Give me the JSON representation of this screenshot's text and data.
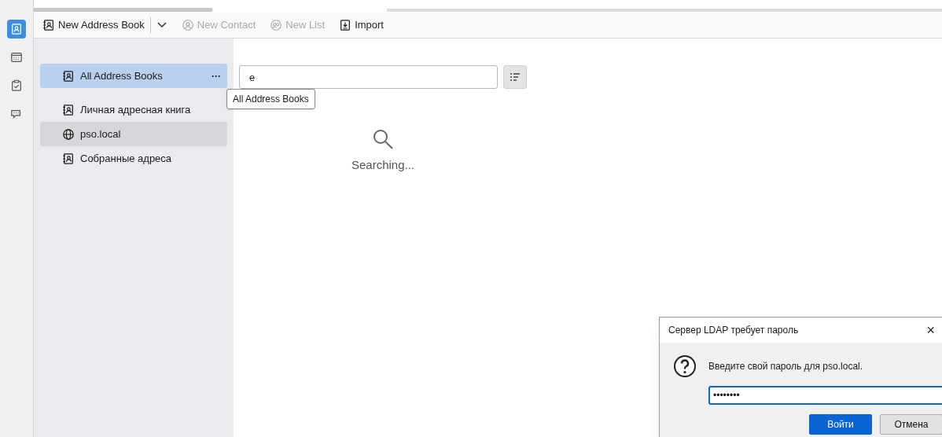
{
  "spaces": [
    {
      "kind": "addressbook",
      "selected": true
    },
    {
      "kind": "calendar",
      "selected": false
    },
    {
      "kind": "tasks",
      "selected": false
    },
    {
      "kind": "chat",
      "selected": false
    }
  ],
  "toolbar": [
    {
      "kind": "book",
      "label": "New Address Book",
      "disabled": false,
      "menu": true
    },
    {
      "kind": "contact",
      "label": "New Contact",
      "disabled": true,
      "menu": false
    },
    {
      "kind": "list",
      "label": "New List",
      "disabled": true,
      "menu": false
    },
    {
      "kind": "import",
      "label": "Import",
      "disabled": false,
      "menu": false
    }
  ],
  "sidebar": {
    "items": [
      {
        "kind": "book",
        "label": "All Address Books",
        "selected": true,
        "hovered": false,
        "more": "···"
      },
      {
        "kind": "book",
        "label": "Личная адресная книга",
        "selected": false,
        "hovered": false
      },
      {
        "kind": "ldap",
        "label": "pso.local",
        "selected": false,
        "hovered": true
      },
      {
        "kind": "book",
        "label": "Собранные адреса",
        "selected": false,
        "hovered": false
      }
    ]
  },
  "tooltip": "All Address Books",
  "search": {
    "value": "e"
  },
  "status": "Searching...",
  "dialog": {
    "title": "Сервер LDAP требует пароль",
    "close": "×",
    "message": "Введите свой пароль для pso.local.",
    "password": "••••••••",
    "buttons": [
      {
        "label": "Войти",
        "default": true
      },
      {
        "label": "Отмена",
        "default": false
      }
    ]
  }
}
